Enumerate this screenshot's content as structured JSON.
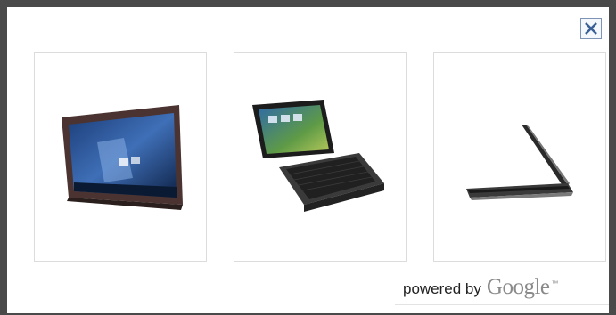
{
  "close": {
    "icon": "close-icon"
  },
  "thumbnails": [
    {
      "name": "tablet-front",
      "icon": "tablet-image"
    },
    {
      "name": "tablet-with-keyboard-dock",
      "icon": "tablet-dock-image"
    },
    {
      "name": "tablet-side-profile",
      "icon": "tablet-side-image"
    }
  ],
  "attribution": {
    "powered_by": "powered by",
    "brand": "Google",
    "trademark": "™"
  },
  "colors": {
    "frame": "#4a4a4a",
    "close_border": "#7d94b7",
    "close_glyph": "#3a5f96",
    "thumb_border": "#dcdcdc"
  }
}
